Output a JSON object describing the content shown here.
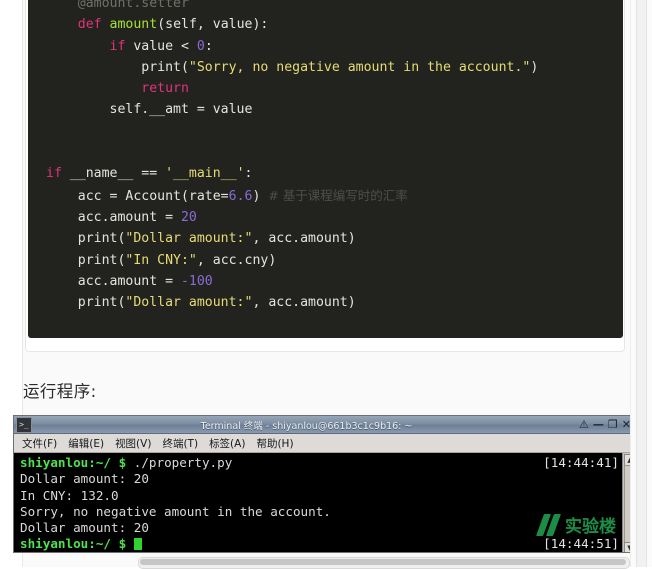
{
  "code_block": {
    "language": "python",
    "lines": [
      [
        {
          "t": "    ",
          "c": "plain"
        },
        {
          "t": "@amount.setter",
          "c": "dec"
        }
      ],
      [
        {
          "t": "    ",
          "c": "plain"
        },
        {
          "t": "def",
          "c": "kw"
        },
        {
          "t": " ",
          "c": "plain"
        },
        {
          "t": "amount",
          "c": "fn"
        },
        {
          "t": "(self, value):",
          "c": "plain"
        }
      ],
      [
        {
          "t": "        ",
          "c": "plain"
        },
        {
          "t": "if",
          "c": "kw"
        },
        {
          "t": " value < ",
          "c": "plain"
        },
        {
          "t": "0",
          "c": "num"
        },
        {
          "t": ":",
          "c": "plain"
        }
      ],
      [
        {
          "t": "            print(",
          "c": "plain"
        },
        {
          "t": "\"Sorry, no negative amount in the account.\"",
          "c": "str"
        },
        {
          "t": ")",
          "c": "plain"
        }
      ],
      [
        {
          "t": "            ",
          "c": "plain"
        },
        {
          "t": "return",
          "c": "kw"
        }
      ],
      [
        {
          "t": "        self.__amt = value",
          "c": "plain"
        }
      ],
      [
        {
          "t": "",
          "c": "plain"
        }
      ],
      [
        {
          "t": "",
          "c": "plain"
        }
      ],
      [
        {
          "t": "",
          "c": "plain"
        },
        {
          "t": "if",
          "c": "kw"
        },
        {
          "t": " __name__ == ",
          "c": "plain"
        },
        {
          "t": "'__main__'",
          "c": "str"
        },
        {
          "t": ":",
          "c": "plain"
        }
      ],
      [
        {
          "t": "    acc = Account(rate=",
          "c": "plain"
        },
        {
          "t": "6.6",
          "c": "num"
        },
        {
          "t": ") ",
          "c": "plain"
        },
        {
          "t": "# 基于课程编写时的汇率",
          "c": "com"
        }
      ],
      [
        {
          "t": "    acc.amount = ",
          "c": "plain"
        },
        {
          "t": "20",
          "c": "num"
        }
      ],
      [
        {
          "t": "    print(",
          "c": "plain"
        },
        {
          "t": "\"Dollar amount:\"",
          "c": "str"
        },
        {
          "t": ", acc.amount)",
          "c": "plain"
        }
      ],
      [
        {
          "t": "    print(",
          "c": "plain"
        },
        {
          "t": "\"In CNY:\"",
          "c": "str"
        },
        {
          "t": ", acc.cny)",
          "c": "plain"
        }
      ],
      [
        {
          "t": "    acc.amount = ",
          "c": "plain"
        },
        {
          "t": "-100",
          "c": "num"
        }
      ],
      [
        {
          "t": "    print(",
          "c": "plain"
        },
        {
          "t": "\"Dollar amount:\"",
          "c": "str"
        },
        {
          "t": ", acc.amount)",
          "c": "plain"
        }
      ]
    ]
  },
  "run_heading": "运行程序:",
  "terminal": {
    "title": "Terminal 终端 - shiyanlou@661b3c1c9b16: ~",
    "icon": "terminal-icon",
    "window_buttons": [
      "⚠",
      "—",
      "❐",
      "✕"
    ],
    "menu": [
      {
        "label": "文件(F)"
      },
      {
        "label": "编辑(E)"
      },
      {
        "label": "视图(V)"
      },
      {
        "label": "终端(T)"
      },
      {
        "label": "标签(A)"
      },
      {
        "label": "帮助(H)"
      }
    ],
    "lines": [
      [
        {
          "t": "shiyanlou:~/ $ ",
          "c": "prompt"
        },
        {
          "t": "./property.py",
          "c": "out"
        }
      ],
      [
        {
          "t": "Dollar amount: 20",
          "c": "out"
        }
      ],
      [
        {
          "t": "In CNY: 132.0",
          "c": "out"
        }
      ],
      [
        {
          "t": "Sorry, no negative amount in the account.",
          "c": "out"
        }
      ],
      [
        {
          "t": "Dollar amount: 20",
          "c": "out"
        }
      ],
      [
        {
          "t": "shiyanlou:~/ $ ",
          "c": "prompt"
        }
      ]
    ],
    "timestamp_top": "[14:44:41]",
    "timestamp_bottom": "[14:44:51]",
    "watermark_text": "实验楼",
    "watermark_color": "#1f9a4d"
  },
  "colors": {
    "code_bg": "#22231f",
    "page_bg": "#fafafa",
    "terminal_bg": "#000000",
    "prompt_green": "#4ee24e",
    "string_yellow": "#e6db74",
    "keyword_pink": "#e0337a",
    "function_green": "#a6e22e",
    "number_purple": "#8a6bd6"
  }
}
